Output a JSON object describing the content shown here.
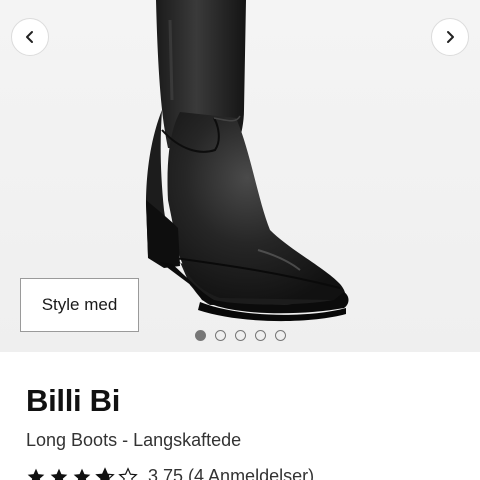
{
  "gallery": {
    "prev_icon": "chevron-left-icon",
    "next_icon": "chevron-right-icon",
    "style_button_label": "Style med",
    "dots_count": 5,
    "active_dot": 1
  },
  "product": {
    "brand": "Billi Bi",
    "name": "Long Boots - Langskaftede",
    "rating_value": 3.75,
    "rating_text": "3,75 (4 Anmeldelser)",
    "stars": [
      "full",
      "full",
      "full",
      "three-quarter",
      "empty"
    ]
  },
  "colors": {
    "star": "#111111",
    "background": "#efefef"
  }
}
